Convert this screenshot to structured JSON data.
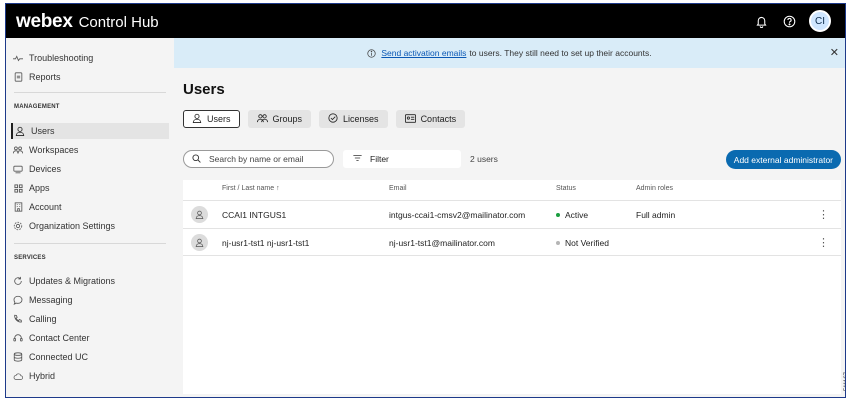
{
  "header": {
    "brand_bold": "webex",
    "brand_rest": "Control Hub",
    "avatar_initials": "CI",
    "icons": [
      "bell-icon",
      "help-icon"
    ]
  },
  "sidebar": {
    "top_items": [
      {
        "label": "Troubleshooting",
        "icon": "pulse-icon"
      },
      {
        "label": "Reports",
        "icon": "document-icon"
      }
    ],
    "management_title": "MANAGEMENT",
    "management_items": [
      {
        "label": "Users",
        "icon": "user-icon",
        "active": true
      },
      {
        "label": "Workspaces",
        "icon": "workspaces-icon"
      },
      {
        "label": "Devices",
        "icon": "device-icon"
      },
      {
        "label": "Apps",
        "icon": "apps-icon"
      },
      {
        "label": "Account",
        "icon": "building-icon"
      },
      {
        "label": "Organization Settings",
        "icon": "gear-icon"
      }
    ],
    "services_title": "SERVICES",
    "services_items": [
      {
        "label": "Updates & Migrations",
        "icon": "refresh-icon"
      },
      {
        "label": "Messaging",
        "icon": "chat-icon"
      },
      {
        "label": "Calling",
        "icon": "phone-icon"
      },
      {
        "label": "Contact Center",
        "icon": "contact-center-icon"
      },
      {
        "label": "Connected UC",
        "icon": "database-icon"
      },
      {
        "label": "Hybrid",
        "icon": "cloud-icon"
      }
    ]
  },
  "banner": {
    "link_text": "Send activation emails",
    "rest_text": "to users. They still need to set up their accounts."
  },
  "main": {
    "title": "Users",
    "tabs": [
      {
        "label": "Users",
        "icon": "user-icon",
        "selected": true
      },
      {
        "label": "Groups",
        "icon": "groups-icon"
      },
      {
        "label": "Licenses",
        "icon": "check-circle-icon"
      },
      {
        "label": "Contacts",
        "icon": "contact-card-icon"
      }
    ],
    "search_placeholder": "Search by name or email",
    "filter_label": "Filter",
    "count_text": "2 users",
    "add_button": "Add external administrator"
  },
  "table": {
    "columns": [
      "First / Last name ↑",
      "Email",
      "Status",
      "Admin roles"
    ],
    "rows": [
      {
        "name": "CCAI1 INTGUS1",
        "email": "intgus-ccai1-cmsv2@mailinator.com",
        "status": "Active",
        "status_color": "#1a9e3f",
        "role": "Full admin"
      },
      {
        "name": "nj-usr1-tst1 nj-usr1-tst1",
        "email": "nj-usr1-tst1@mailinator.com",
        "status": "Not Verified",
        "status_color": "#b5b5b5",
        "role": ""
      }
    ]
  },
  "figure_id": "511167",
  "colors": {
    "accent": "#0a6ab0",
    "banner_bg": "#d9ecf8",
    "topbar_bg": "#000000"
  }
}
